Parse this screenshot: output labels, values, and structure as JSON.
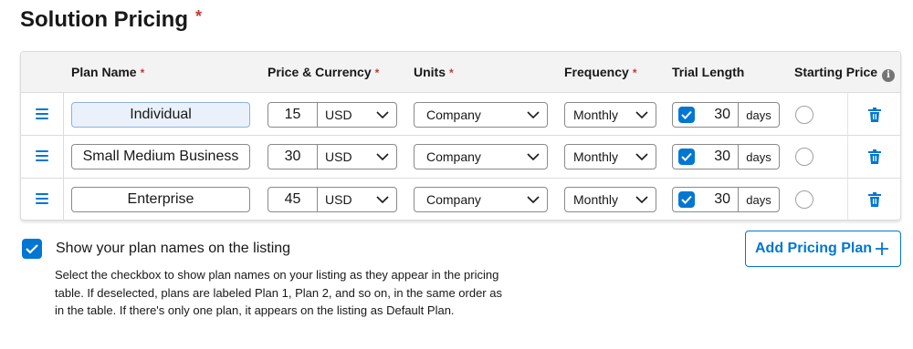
{
  "section": {
    "title": "Solution Pricing",
    "required_mark": "*"
  },
  "columns": {
    "plan_name": "Plan Name",
    "price_currency": "Price & Currency",
    "units": "Units",
    "frequency": "Frequency",
    "trial_length": "Trial Length",
    "starting_price": "Starting Price",
    "required_mark": "*"
  },
  "plans": [
    {
      "name": "Individual",
      "price": "15",
      "currency": "USD",
      "units": "Company",
      "frequency": "Monthly",
      "trial_enabled": true,
      "trial_length": "30",
      "trial_unit": "days",
      "starting_price": false
    },
    {
      "name": "Small Medium Business",
      "price": "30",
      "currency": "USD",
      "units": "Company",
      "frequency": "Monthly",
      "trial_enabled": true,
      "trial_length": "30",
      "trial_unit": "days",
      "starting_price": false
    },
    {
      "name": "Enterprise",
      "price": "45",
      "currency": "USD",
      "units": "Company",
      "frequency": "Monthly",
      "trial_enabled": true,
      "trial_length": "30",
      "trial_unit": "days",
      "starting_price": false
    }
  ],
  "show_plan_names": {
    "checked": true,
    "label": "Show your plan names on the listing",
    "help": "Select the checkbox to show plan names on your listing as they appear in the pricing table. If deselected, plans are labeled Plan 1, Plan 2, and so on, in the same order as in the table. If there's only one plan, it appears on the listing as Default Plan."
  },
  "add_pricing_plan_label": "Add Pricing Plan",
  "colors": {
    "brand": "#0176d3",
    "required": "#c23934",
    "active_field": "#ebf1fb"
  },
  "icons": [
    "drag-handle-icon",
    "chevron-down-icon",
    "checkmark-icon",
    "trash-icon",
    "info-icon",
    "plus-icon"
  ]
}
